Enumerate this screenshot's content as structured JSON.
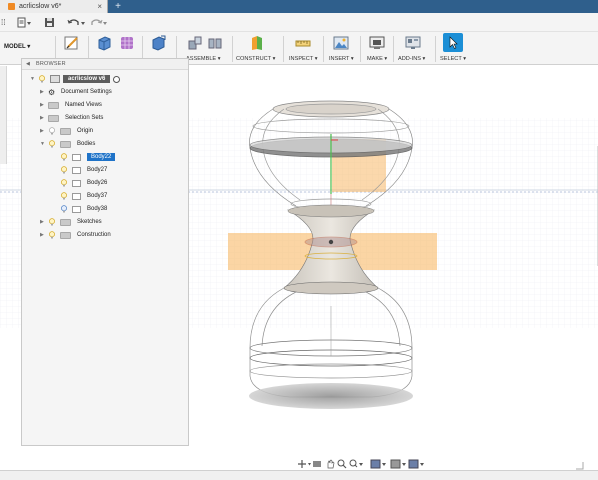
{
  "window": {
    "tab_title": "acrlicslow v6*",
    "tab_close": "×",
    "new_tab": "+"
  },
  "quick_access": {
    "grid": "⁞⁞",
    "file": "▾",
    "save": "💾",
    "undo": "↶ ▾",
    "redo": "↷ ▾"
  },
  "ribbon": {
    "workspace": "MODEL ▾",
    "groups": [
      {
        "label": "ASSEMBLE ▾"
      },
      {
        "label": "CONSTRUCT ▾"
      },
      {
        "label": "INSPECT ▾"
      },
      {
        "label": "INSERT ▾"
      },
      {
        "label": "MAKE ▾"
      },
      {
        "label": "ADD-INS ▾"
      },
      {
        "label": "SELECT ▾"
      }
    ]
  },
  "browser": {
    "header": "BROWSER",
    "root": "acrlicslow v6",
    "items": [
      {
        "label": "Document Settings"
      },
      {
        "label": "Named Views"
      },
      {
        "label": "Selection Sets"
      },
      {
        "label": "Origin"
      },
      {
        "label": "Bodies"
      },
      {
        "label": "Body22"
      },
      {
        "label": "Body27"
      },
      {
        "label": "Body26"
      },
      {
        "label": "Body37"
      },
      {
        "label": "Body38"
      },
      {
        "label": "Sketches"
      },
      {
        "label": "Construction"
      }
    ]
  },
  "colors": {
    "accent": "#1f73c8",
    "tab_bar": "#2f5f8c",
    "plane": "#f7b25a",
    "bulb": "#e9c23a"
  }
}
